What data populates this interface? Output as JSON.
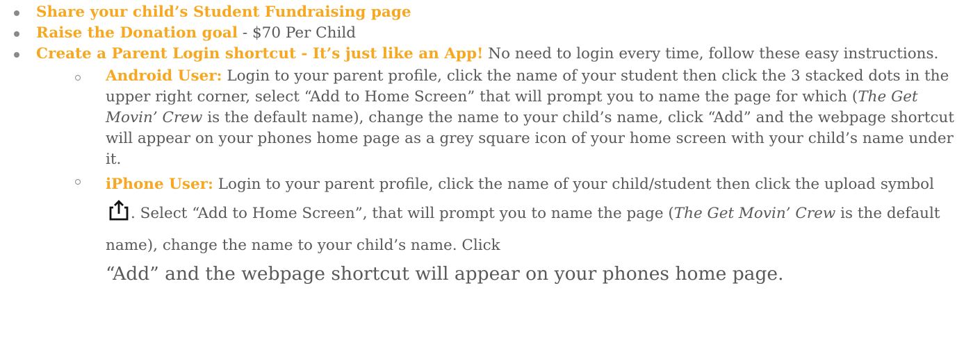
{
  "items": [
    {
      "title": "Share your child’s Student Fundraising page"
    },
    {
      "title": "Raise the Donation goal",
      "sep": " - ",
      "text": "$70 Per Child"
    },
    {
      "title": "Create a Parent Login shortcut",
      "sep": " - ",
      "highlight": "It’s just like an App!",
      "text": " No need to login every time, follow these easy instructions."
    }
  ],
  "android": {
    "label": "Android User:",
    "t1": " Login to your parent profile, click the name of your student then click the 3 stacked dots in the upper right corner, select “Add to Home Screen” that will prompt you to name the page for which (",
    "italic": "The Get Movin’ Crew",
    "t2": " is the default name), change the name to your child’s name, click “Add” and the webpage shortcut will appear on your phones home page as a grey square icon of your home screen with your child’s name under it."
  },
  "iphone": {
    "label": "iPhone User:",
    "t1": " Login to your parent profile, click the name of your child/student then click the upload symbol ",
    "icon": "share-upload-icon",
    "t2": ". Select “Add to Home Screen”, that will prompt you to name the page (",
    "italic": "The Get Movin’ Crew",
    "t3": " is the default name), change the name to your child’s name. Click",
    "t4": "“Add” and the webpage shortcut will appear on your phones home page."
  },
  "colors": {
    "accent": "#f7a823",
    "text": "#595959"
  }
}
